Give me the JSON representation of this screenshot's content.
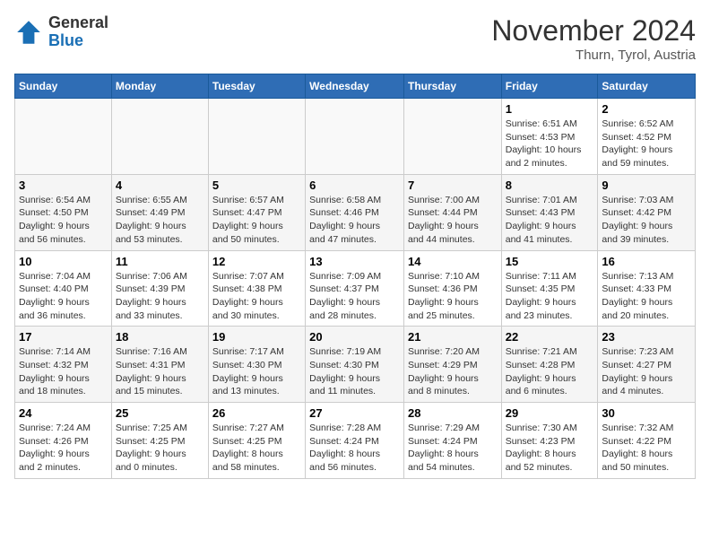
{
  "logo": {
    "general": "General",
    "blue": "Blue"
  },
  "title": "November 2024",
  "location": "Thurn, Tyrol, Austria",
  "headers": [
    "Sunday",
    "Monday",
    "Tuesday",
    "Wednesday",
    "Thursday",
    "Friday",
    "Saturday"
  ],
  "weeks": [
    [
      {
        "day": "",
        "info": ""
      },
      {
        "day": "",
        "info": ""
      },
      {
        "day": "",
        "info": ""
      },
      {
        "day": "",
        "info": ""
      },
      {
        "day": "",
        "info": ""
      },
      {
        "day": "1",
        "info": "Sunrise: 6:51 AM\nSunset: 4:53 PM\nDaylight: 10 hours\nand 2 minutes."
      },
      {
        "day": "2",
        "info": "Sunrise: 6:52 AM\nSunset: 4:52 PM\nDaylight: 9 hours\nand 59 minutes."
      }
    ],
    [
      {
        "day": "3",
        "info": "Sunrise: 6:54 AM\nSunset: 4:50 PM\nDaylight: 9 hours\nand 56 minutes."
      },
      {
        "day": "4",
        "info": "Sunrise: 6:55 AM\nSunset: 4:49 PM\nDaylight: 9 hours\nand 53 minutes."
      },
      {
        "day": "5",
        "info": "Sunrise: 6:57 AM\nSunset: 4:47 PM\nDaylight: 9 hours\nand 50 minutes."
      },
      {
        "day": "6",
        "info": "Sunrise: 6:58 AM\nSunset: 4:46 PM\nDaylight: 9 hours\nand 47 minutes."
      },
      {
        "day": "7",
        "info": "Sunrise: 7:00 AM\nSunset: 4:44 PM\nDaylight: 9 hours\nand 44 minutes."
      },
      {
        "day": "8",
        "info": "Sunrise: 7:01 AM\nSunset: 4:43 PM\nDaylight: 9 hours\nand 41 minutes."
      },
      {
        "day": "9",
        "info": "Sunrise: 7:03 AM\nSunset: 4:42 PM\nDaylight: 9 hours\nand 39 minutes."
      }
    ],
    [
      {
        "day": "10",
        "info": "Sunrise: 7:04 AM\nSunset: 4:40 PM\nDaylight: 9 hours\nand 36 minutes."
      },
      {
        "day": "11",
        "info": "Sunrise: 7:06 AM\nSunset: 4:39 PM\nDaylight: 9 hours\nand 33 minutes."
      },
      {
        "day": "12",
        "info": "Sunrise: 7:07 AM\nSunset: 4:38 PM\nDaylight: 9 hours\nand 30 minutes."
      },
      {
        "day": "13",
        "info": "Sunrise: 7:09 AM\nSunset: 4:37 PM\nDaylight: 9 hours\nand 28 minutes."
      },
      {
        "day": "14",
        "info": "Sunrise: 7:10 AM\nSunset: 4:36 PM\nDaylight: 9 hours\nand 25 minutes."
      },
      {
        "day": "15",
        "info": "Sunrise: 7:11 AM\nSunset: 4:35 PM\nDaylight: 9 hours\nand 23 minutes."
      },
      {
        "day": "16",
        "info": "Sunrise: 7:13 AM\nSunset: 4:33 PM\nDaylight: 9 hours\nand 20 minutes."
      }
    ],
    [
      {
        "day": "17",
        "info": "Sunrise: 7:14 AM\nSunset: 4:32 PM\nDaylight: 9 hours\nand 18 minutes."
      },
      {
        "day": "18",
        "info": "Sunrise: 7:16 AM\nSunset: 4:31 PM\nDaylight: 9 hours\nand 15 minutes."
      },
      {
        "day": "19",
        "info": "Sunrise: 7:17 AM\nSunset: 4:30 PM\nDaylight: 9 hours\nand 13 minutes."
      },
      {
        "day": "20",
        "info": "Sunrise: 7:19 AM\nSunset: 4:30 PM\nDaylight: 9 hours\nand 11 minutes."
      },
      {
        "day": "21",
        "info": "Sunrise: 7:20 AM\nSunset: 4:29 PM\nDaylight: 9 hours\nand 8 minutes."
      },
      {
        "day": "22",
        "info": "Sunrise: 7:21 AM\nSunset: 4:28 PM\nDaylight: 9 hours\nand 6 minutes."
      },
      {
        "day": "23",
        "info": "Sunrise: 7:23 AM\nSunset: 4:27 PM\nDaylight: 9 hours\nand 4 minutes."
      }
    ],
    [
      {
        "day": "24",
        "info": "Sunrise: 7:24 AM\nSunset: 4:26 PM\nDaylight: 9 hours\nand 2 minutes."
      },
      {
        "day": "25",
        "info": "Sunrise: 7:25 AM\nSunset: 4:25 PM\nDaylight: 9 hours\nand 0 minutes."
      },
      {
        "day": "26",
        "info": "Sunrise: 7:27 AM\nSunset: 4:25 PM\nDaylight: 8 hours\nand 58 minutes."
      },
      {
        "day": "27",
        "info": "Sunrise: 7:28 AM\nSunset: 4:24 PM\nDaylight: 8 hours\nand 56 minutes."
      },
      {
        "day": "28",
        "info": "Sunrise: 7:29 AM\nSunset: 4:24 PM\nDaylight: 8 hours\nand 54 minutes."
      },
      {
        "day": "29",
        "info": "Sunrise: 7:30 AM\nSunset: 4:23 PM\nDaylight: 8 hours\nand 52 minutes."
      },
      {
        "day": "30",
        "info": "Sunrise: 7:32 AM\nSunset: 4:22 PM\nDaylight: 8 hours\nand 50 minutes."
      }
    ]
  ]
}
